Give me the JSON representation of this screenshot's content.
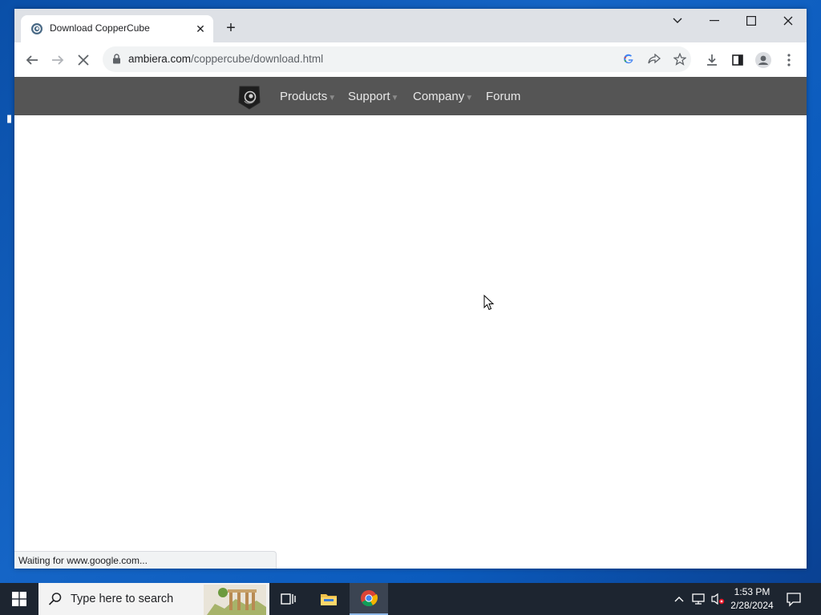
{
  "browser": {
    "tab_title": "Download CopperCube",
    "url_host": "ambiera.com",
    "url_path": "/coppercube/download.html",
    "status_text": "Waiting for www.google.com..."
  },
  "site": {
    "nav": [
      {
        "label": "Products",
        "has_menu": true
      },
      {
        "label": "Support",
        "has_menu": true
      },
      {
        "label": "Company",
        "has_menu": true
      },
      {
        "label": "Forum",
        "has_menu": false
      }
    ],
    "nav_arrow": "▼",
    "nav_bg": "#555555"
  },
  "taskbar": {
    "search_placeholder": "Type here to search",
    "time": "1:53 PM",
    "date": "2/28/2024"
  },
  "colors": {
    "desktop": "#1565c6",
    "taskbar": "#1d2530"
  }
}
